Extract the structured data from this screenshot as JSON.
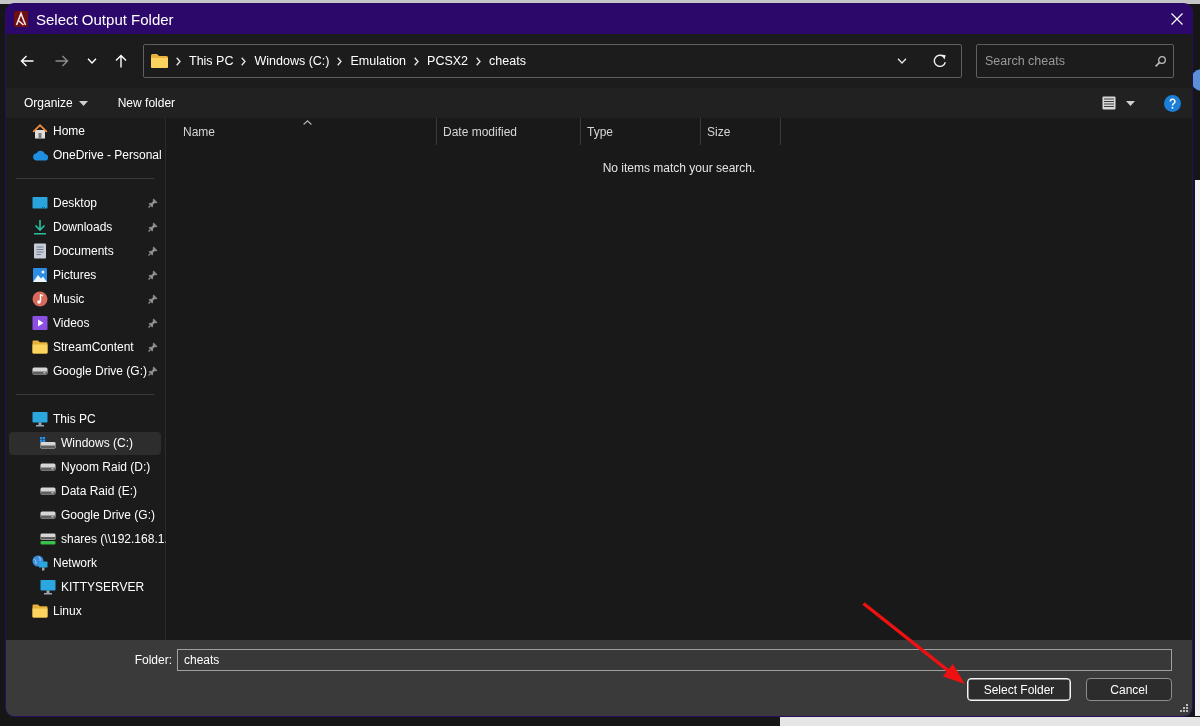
{
  "window": {
    "title": "Select Output Folder"
  },
  "navigation": {
    "buttons": [
      {
        "kind": "back",
        "disabled": false
      },
      {
        "kind": "forward",
        "disabled": true
      },
      {
        "kind": "recent",
        "disabled": false
      },
      {
        "kind": "up",
        "disabled": false
      }
    ],
    "address": {
      "crumbs": [
        "This PC",
        "Windows (C:)",
        "Emulation",
        "PCSX2",
        "cheats"
      ]
    },
    "search": {
      "placeholder": "Search cheats"
    }
  },
  "toolbar": {
    "items": [
      {
        "label": "Organize",
        "kind": "menu"
      },
      {
        "label": "New folder",
        "kind": "button"
      }
    ]
  },
  "sidebar": {
    "groups": [
      {
        "items": [
          {
            "label": "Home",
            "kind": "home",
            "selected": false
          },
          {
            "label": "OneDrive - Personal",
            "kind": "cloud",
            "selected": false
          }
        ]
      },
      {
        "items": [
          {
            "label": "Desktop",
            "kind": "desktop",
            "pinned": true,
            "selected": false
          },
          {
            "label": "Downloads",
            "kind": "download",
            "pinned": true,
            "selected": false
          },
          {
            "label": "Documents",
            "kind": "document",
            "pinned": true,
            "selected": false
          },
          {
            "label": "Pictures",
            "kind": "picture",
            "pinned": true,
            "selected": false
          },
          {
            "label": "Music",
            "kind": "music",
            "pinned": true,
            "selected": false
          },
          {
            "label": "Videos",
            "kind": "video",
            "pinned": true,
            "selected": false
          },
          {
            "label": "StreamContent",
            "kind": "folder",
            "pinned": true,
            "selected": false
          },
          {
            "label": "Google Drive (G:)",
            "kind": "drive",
            "pinned": true,
            "selected": false
          }
        ]
      },
      {
        "items": [
          {
            "label": "This PC",
            "kind": "pc",
            "selected": false,
            "children": [
              {
                "label": "Windows (C:)",
                "kind": "system-drive",
                "selected": true
              },
              {
                "label": "Nyoom Raid (D:)",
                "kind": "drive",
                "selected": false
              },
              {
                "label": "Data Raid (E:)",
                "kind": "drive",
                "selected": false
              },
              {
                "label": "Google Drive (G:)",
                "kind": "drive",
                "selected": false
              },
              {
                "label": "shares (\\\\192.168.1.",
                "kind": "network-drive",
                "selected": false
              }
            ]
          },
          {
            "label": "Network",
            "kind": "network",
            "selected": false,
            "children": [
              {
                "label": "KITTYSERVER",
                "kind": "pc",
                "selected": false
              }
            ]
          },
          {
            "label": "Linux",
            "kind": "folder",
            "selected": false
          }
        ]
      }
    ]
  },
  "file_list": {
    "columns": [
      {
        "label": "Name",
        "sorted": true
      },
      {
        "label": "Date modified",
        "sorted": false
      },
      {
        "label": "Type",
        "sorted": false
      },
      {
        "label": "Size",
        "sorted": false
      }
    ],
    "empty_message": "No items match your search."
  },
  "footer": {
    "folder": {
      "label": "Folder:",
      "value": "cheats"
    },
    "buttons": [
      {
        "label": "Select Folder",
        "default": true
      },
      {
        "label": "Cancel",
        "default": false
      }
    ]
  }
}
